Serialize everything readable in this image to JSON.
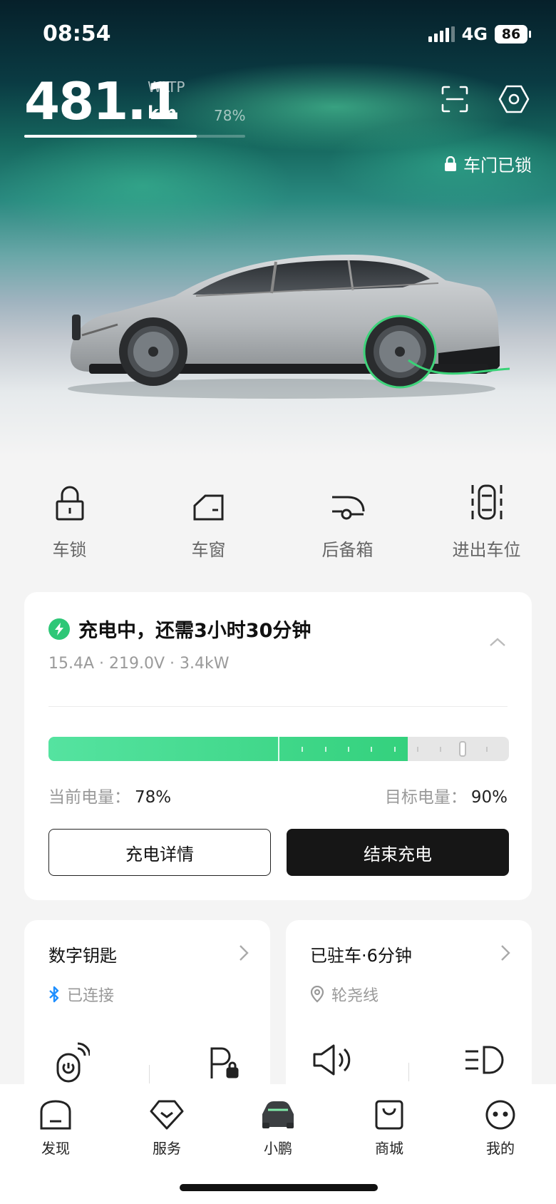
{
  "status_bar": {
    "time": "08:54",
    "network": "4G",
    "battery": "86"
  },
  "range": {
    "value": "481.1",
    "standard": "WLTP",
    "unit": "km",
    "battery_percent": "78%",
    "battery_fraction": 0.78
  },
  "top_actions": {
    "scan_icon": "scan-icon",
    "settings_icon": "hexagon-settings-icon"
  },
  "door_status": {
    "label": "车门已锁",
    "icon": "lock-icon"
  },
  "quick_actions": [
    {
      "label": "车锁",
      "icon": "padlock-icon"
    },
    {
      "label": "车窗",
      "icon": "window-icon"
    },
    {
      "label": "后备箱",
      "icon": "trunk-icon"
    },
    {
      "label": "进出车位",
      "icon": "parking-maneuver-icon"
    }
  ],
  "charging": {
    "title": "充电中，还需3小时30分钟",
    "specs": "15.4A  ·  219.0V · 3.4kW",
    "current_label": "当前电量：",
    "current_value": "78%",
    "current_fraction": 0.78,
    "target_label": "目标电量：",
    "target_value": "90%",
    "target_fraction": 0.9,
    "detail_button": "充电详情",
    "stop_button": "结束充电",
    "accent_color": "#2ec777"
  },
  "digital_key": {
    "title": "数字钥匙",
    "status": "已连接",
    "status_icon": "bluetooth-icon"
  },
  "parking": {
    "title": "已驻车·6分钟",
    "location": "轮尧线",
    "location_icon": "location-pin-icon"
  },
  "tabbar": [
    {
      "label": "发现",
      "icon": "discover-icon"
    },
    {
      "label": "服务",
      "icon": "service-icon"
    },
    {
      "label": "小鹏",
      "icon": "car-icon",
      "active": true
    },
    {
      "label": "商城",
      "icon": "shop-icon"
    },
    {
      "label": "我的",
      "icon": "profile-icon"
    }
  ]
}
